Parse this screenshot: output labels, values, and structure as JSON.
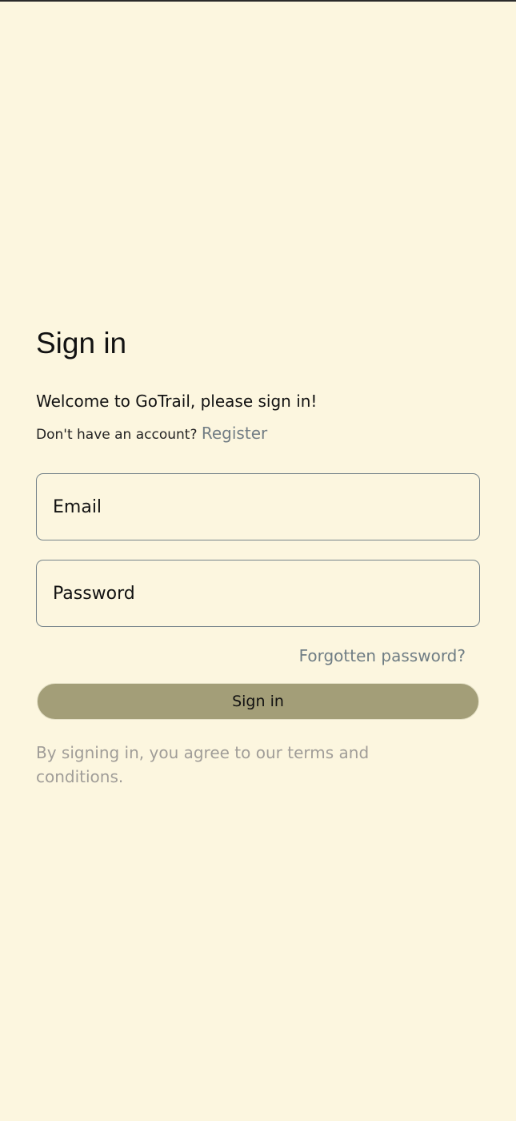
{
  "page": {
    "title": "Sign in",
    "welcome": "Welcome to GoTrail, please sign in!",
    "no_account_text": "Don't have an account?",
    "register_label": "Register"
  },
  "form": {
    "email_placeholder": "Email",
    "password_placeholder": "Password",
    "forgot_label": "Forgotten password?",
    "submit_label": "Sign in"
  },
  "footer": {
    "terms": "By signing in, you agree to our terms and conditions."
  },
  "colors": {
    "background": "#fcf6df",
    "button": "#a39e78",
    "link": "#727d84",
    "muted": "#a09d98",
    "field_border": "#75838a"
  }
}
